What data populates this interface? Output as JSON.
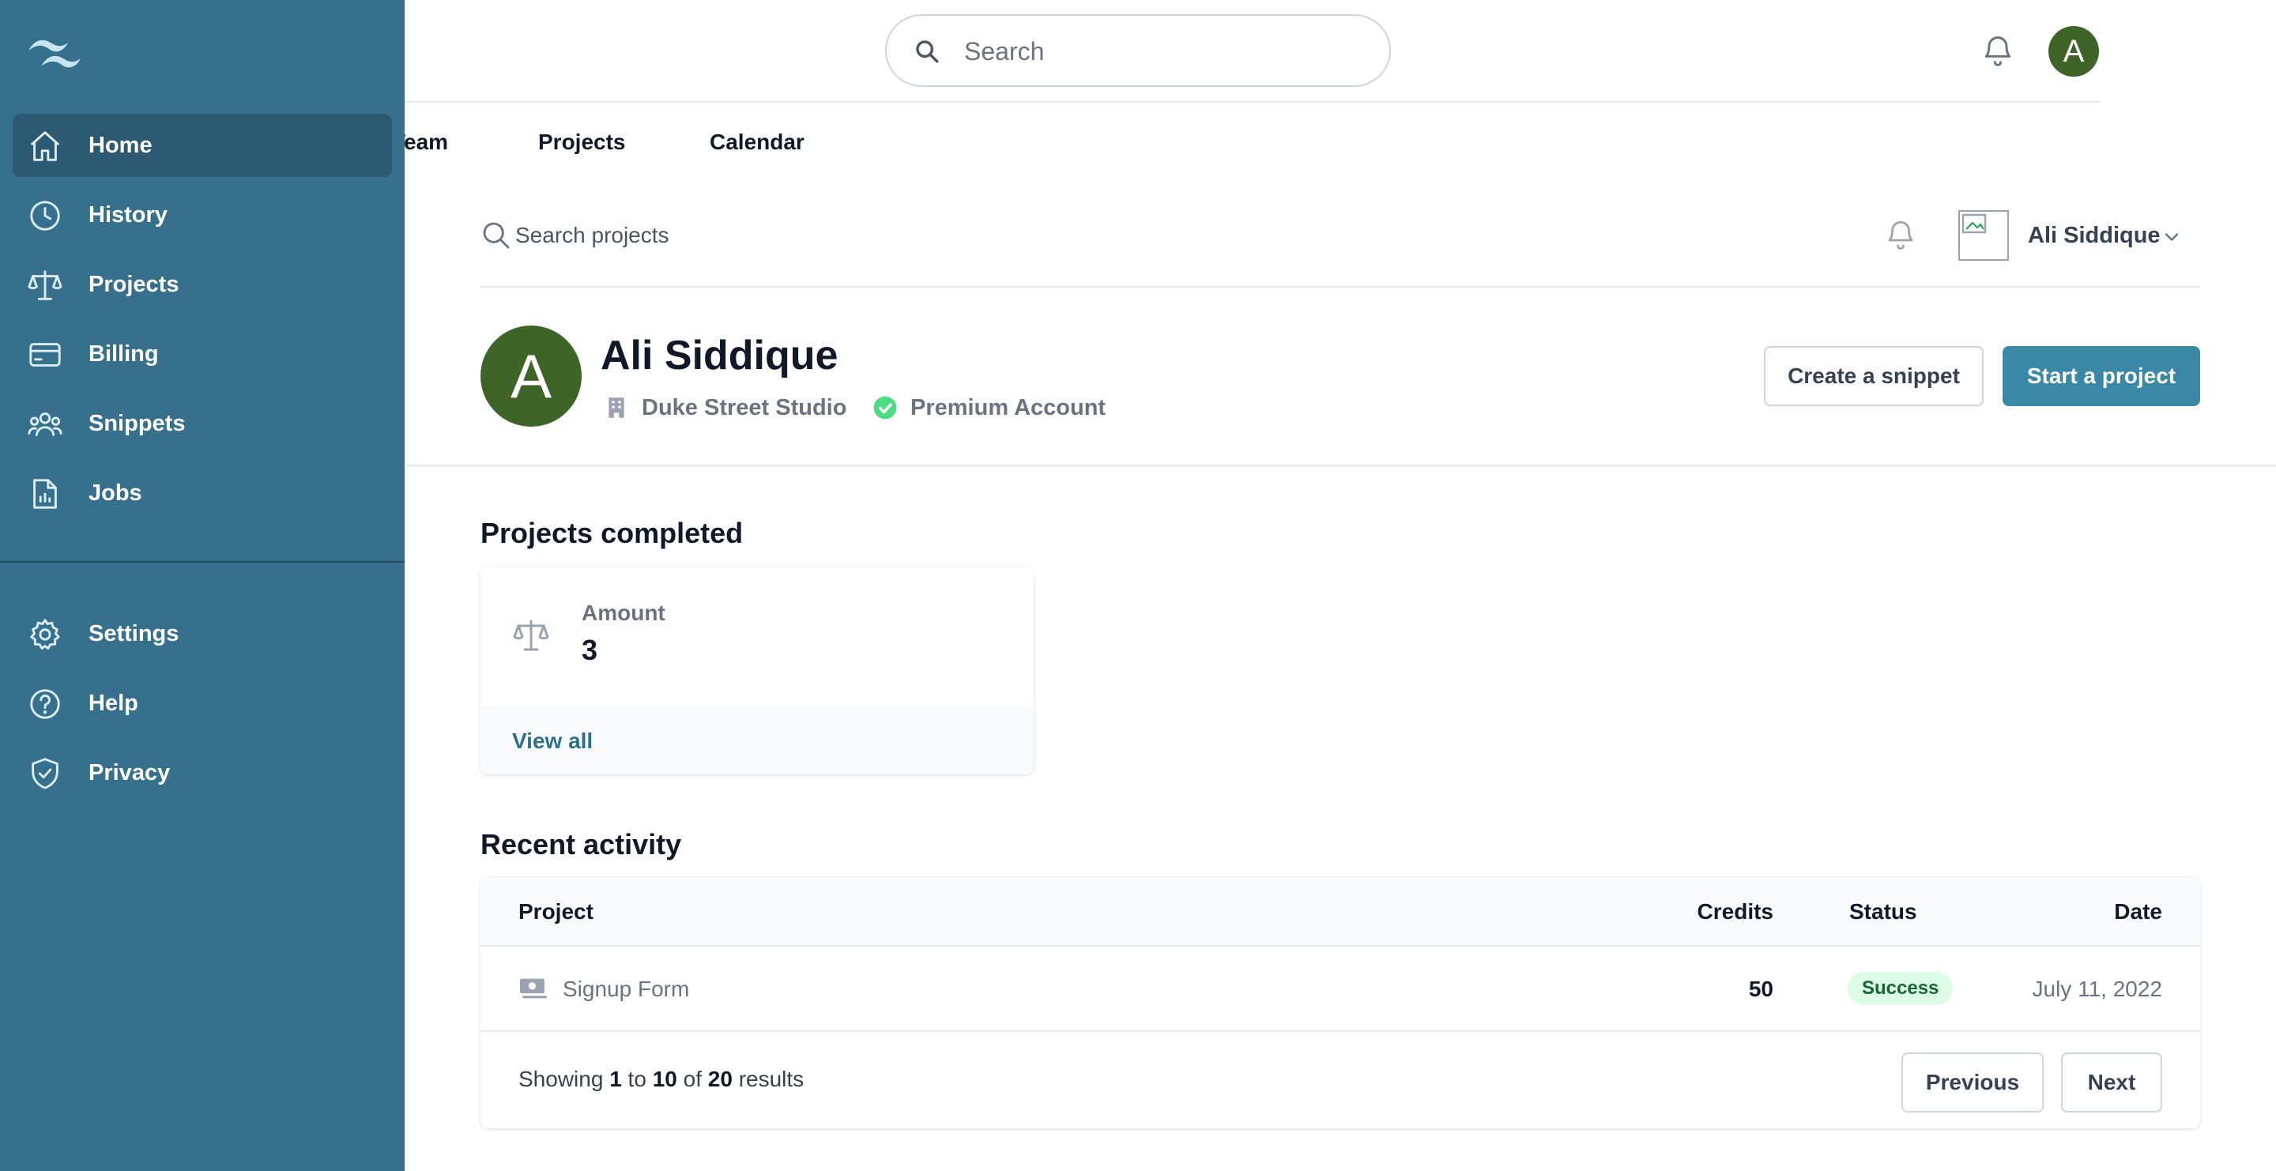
{
  "topbar": {
    "search_placeholder": "Search",
    "avatar_initial": "A"
  },
  "tabs": [
    {
      "label": "Team"
    },
    {
      "label": "Projects"
    },
    {
      "label": "Calendar"
    }
  ],
  "subheader": {
    "search_placeholder": "Search projects",
    "user_name": "Ali Siddique"
  },
  "profile": {
    "avatar_initial": "A",
    "name": "Ali Siddique",
    "studio": "Duke Street Studio",
    "account": "Premium Account",
    "create_snippet_label": "Create a snippet",
    "start_project_label": "Start a project"
  },
  "projects_completed": {
    "title": "Projects completed",
    "label": "Amount",
    "value": "3",
    "link": "View all"
  },
  "recent_activity": {
    "title": "Recent activity",
    "columns": [
      "Project",
      "Credits",
      "Status",
      "Date"
    ],
    "rows": [
      {
        "project": "Signup Form",
        "credits": "50",
        "status": "Success",
        "date": "July 11, 2022"
      }
    ],
    "pagination": {
      "prefix": "Showing",
      "from": "1",
      "to_word": "to",
      "to": "10",
      "of_word": "of",
      "total": "20",
      "suffix": "results",
      "previous_label": "Previous",
      "next_label": "Next"
    }
  },
  "sidebar": {
    "items": [
      {
        "label": "Home",
        "icon": "home-icon",
        "active": true
      },
      {
        "label": "History",
        "icon": "clock-icon"
      },
      {
        "label": "Projects",
        "icon": "scale-icon"
      },
      {
        "label": "Billing",
        "icon": "credit-card-icon"
      },
      {
        "label": "Snippets",
        "icon": "user-group-icon"
      },
      {
        "label": "Jobs",
        "icon": "document-chart-icon"
      }
    ],
    "secondary_items": [
      {
        "label": "Settings",
        "icon": "cog-icon"
      },
      {
        "label": "Help",
        "icon": "question-circle-icon"
      },
      {
        "label": "Privacy",
        "icon": "shield-check-icon"
      }
    ]
  },
  "colors": {
    "sidebar": "#36708c",
    "sidebar_active": "#2b5a72",
    "accent_button": "#3a87a6",
    "avatar": "#3f6427",
    "success_badge_bg": "#dcfce7",
    "success_badge_text": "#166534"
  }
}
